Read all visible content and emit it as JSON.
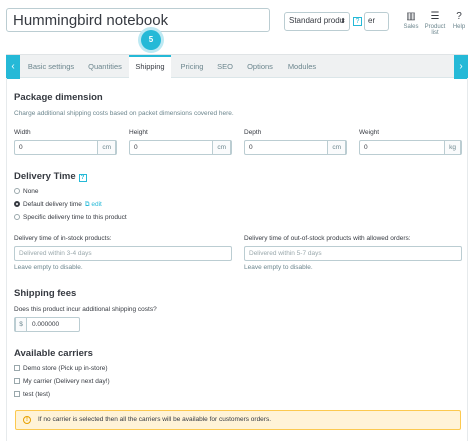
{
  "header": {
    "product_name": "Hummingbird notebook",
    "product_type": "Standard produ",
    "language": "er",
    "actions": [
      {
        "label": "Sales",
        "icon": "bar-chart-icon"
      },
      {
        "label": "Product list",
        "icon": "list-icon"
      },
      {
        "label": "Help",
        "icon": "help-icon"
      }
    ]
  },
  "step_badge": "5",
  "tabs": [
    "Basic settings",
    "Quantities",
    "Shipping",
    "Pricing",
    "SEO",
    "Options",
    "Modules"
  ],
  "active_tab": "Shipping",
  "package": {
    "title": "Package dimension",
    "subtitle": "Charge additional shipping costs based on packet dimensions covered here.",
    "fields": [
      {
        "label": "Width",
        "value": "0",
        "unit": "cm"
      },
      {
        "label": "Height",
        "value": "0",
        "unit": "cm"
      },
      {
        "label": "Depth",
        "value": "0",
        "unit": "cm"
      },
      {
        "label": "Weight",
        "value": "0",
        "unit": "kg"
      }
    ]
  },
  "delivery": {
    "title": "Delivery Time",
    "options": [
      "None",
      "Default delivery time",
      "Specific delivery time to this product"
    ],
    "selected": "Default delivery time",
    "edit_label": "edit",
    "in_stock_label": "Delivery time of in-stock products:",
    "in_stock_placeholder": "Delivered within 3-4 days",
    "out_stock_label": "Delivery time of out-of-stock products with allowed orders:",
    "out_stock_placeholder": "Delivered within 5-7 days",
    "help_text": "Leave empty to disable."
  },
  "fees": {
    "title": "Shipping fees",
    "question": "Does this product incur additional shipping costs?",
    "currency": "$",
    "value": "0.000000"
  },
  "carriers": {
    "title": "Available carriers",
    "items": [
      "Demo store (Pick up in-store)",
      "My carrier (Delivery next day!)",
      "test (test)"
    ],
    "alert": "If no carrier is selected then all the carriers will be available for customers orders."
  }
}
